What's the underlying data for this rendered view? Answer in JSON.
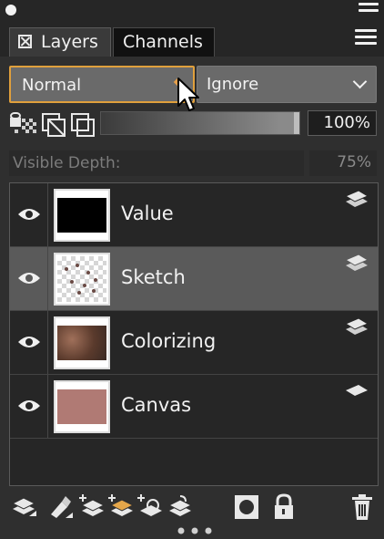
{
  "tabs": [
    {
      "label": "Layers",
      "active": true
    },
    {
      "label": "Channels",
      "active": false
    }
  ],
  "blend": {
    "mode": "Normal",
    "ignore": "Ignore"
  },
  "opacity": {
    "value_text": "100%",
    "fraction": 1.0
  },
  "depth": {
    "label": "Visible Depth:",
    "value_text": "75%"
  },
  "layers": [
    {
      "name": "Value",
      "visible": true,
      "selected": false,
      "thumb": "black"
    },
    {
      "name": "Sketch",
      "visible": true,
      "selected": true,
      "thumb": "checker"
    },
    {
      "name": "Colorizing",
      "visible": true,
      "selected": false,
      "thumb": "color"
    },
    {
      "name": "Canvas",
      "visible": true,
      "selected": false,
      "thumb": "pink"
    }
  ],
  "colors": {
    "accent": "#e0a03c",
    "panel": "#2f2f2f",
    "selected_row": "#5a5a5a",
    "canvas_thumb": "#b07a74"
  },
  "toolbar_icons": [
    "layer-stack-icon",
    "fill-tool-icon",
    "new-layer-icon",
    "new-paint-layer-icon",
    "new-tracing-layer-icon",
    "duplicate-layer-icon",
    "mask-icon",
    "lock-icon",
    "trash-icon"
  ]
}
